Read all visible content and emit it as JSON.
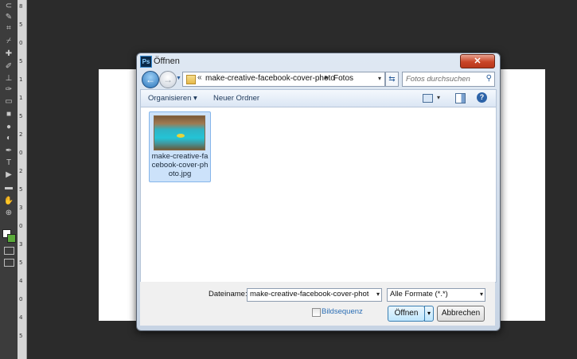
{
  "app": {
    "toolbar": {
      "tools": [
        {
          "icon": "lasso-icon",
          "glyph": "⊂"
        },
        {
          "icon": "magic-wand-icon",
          "glyph": "✎"
        },
        {
          "icon": "crop-icon",
          "glyph": "⌗"
        },
        {
          "icon": "eyedropper-icon",
          "glyph": "⌿"
        },
        {
          "icon": "healing-brush-icon",
          "glyph": "✚"
        },
        {
          "icon": "brush-icon",
          "glyph": "✐"
        },
        {
          "icon": "clone-stamp-icon",
          "glyph": "⊥"
        },
        {
          "icon": "history-brush-icon",
          "glyph": "✑"
        },
        {
          "icon": "eraser-icon",
          "glyph": "▭"
        },
        {
          "icon": "gradient-icon",
          "glyph": "■"
        },
        {
          "icon": "blur-icon",
          "glyph": "●"
        },
        {
          "icon": "dodge-icon",
          "glyph": "◐"
        },
        {
          "icon": "pen-icon",
          "glyph": "✒"
        },
        {
          "icon": "type-icon",
          "glyph": "T"
        },
        {
          "icon": "path-selection-icon",
          "glyph": "▶"
        },
        {
          "icon": "rectangle-shape-icon",
          "glyph": "▬"
        },
        {
          "icon": "hand-icon",
          "glyph": "✋"
        },
        {
          "icon": "zoom-icon",
          "glyph": "⊕"
        }
      ],
      "colors": {
        "foreground": "#ffffff",
        "background": "#5aaa3a"
      }
    },
    "ruler_numbers": [
      "8",
      "5",
      "0",
      "5",
      "1",
      "1",
      "5",
      "2",
      "0",
      "2",
      "5",
      "3",
      "0",
      "3",
      "5",
      "4",
      "0",
      "4",
      "5"
    ]
  },
  "dialog": {
    "title": "Öffnen",
    "close_glyph": "✕",
    "nav": {
      "back_glyph": "←",
      "forward_glyph": "→",
      "history_glyph": "▼",
      "breadcrumb_overflow": "«",
      "path": [
        "make-creative-facebook-cover-photo",
        "Fotos"
      ],
      "separator": "▸",
      "refresh_glyph": "⇆",
      "search_placeholder": "Fotos durchsuchen",
      "search_glyph": "⚲"
    },
    "commands": {
      "organize": "Organisieren ▾",
      "new_folder": "Neuer Ordner",
      "help_glyph": "?"
    },
    "files": [
      {
        "name": "make-creative-facebook-cover-photo.jpg",
        "lines": [
          "make-creative-fa",
          "cebook-cover-ph",
          "oto.jpg"
        ]
      }
    ],
    "bottom": {
      "filename_label": "Dateiname:",
      "filename_value": "make-creative-facebook-cover-photo.jp",
      "format_value": "Alle Formate (*.*)",
      "sequence_label": "Bildsequenz",
      "open_label": "Öffnen",
      "cancel_label": "Abbrechen",
      "dropdown_glyph": "▾"
    }
  }
}
